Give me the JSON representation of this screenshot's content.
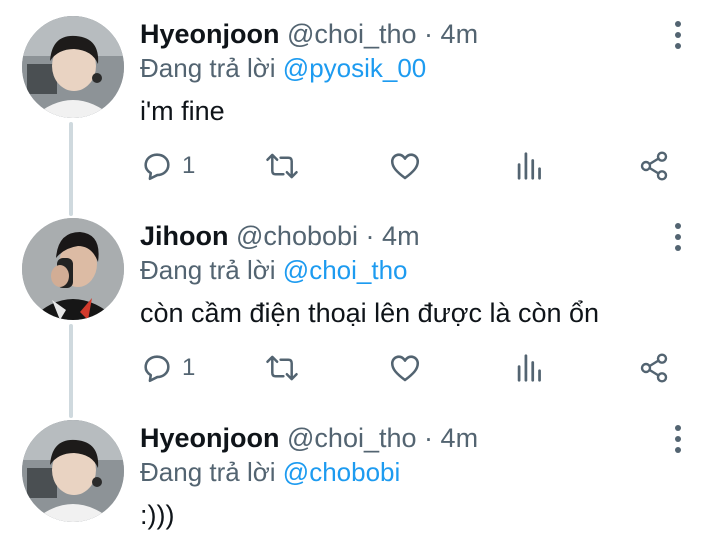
{
  "tweets": [
    {
      "name": "Hyeonjoon",
      "handle": "@choi_tho",
      "separator": "·",
      "time": "4m",
      "reply_prefix": "Đang trả lời",
      "reply_to": "@pyosik_00",
      "text": "i'm fine",
      "reply_count": "1"
    },
    {
      "name": "Jihoon",
      "handle": "@chobobi",
      "separator": "·",
      "time": "4m",
      "reply_prefix": "Đang trả lời",
      "reply_to": "@choi_tho",
      "text": "còn cầm điện thoại lên được là còn ổn",
      "reply_count": "1"
    },
    {
      "name": "Hyeonjoon",
      "handle": "@choi_tho",
      "separator": "·",
      "time": "4m",
      "reply_prefix": "Đang trả lời",
      "reply_to": "@chobobi",
      "text": ":)))"
    }
  ],
  "icons": {
    "reply": "comment-bubble-icon",
    "retweet": "retweet-icon",
    "like": "heart-icon",
    "views": "bar-chart-icon",
    "share": "share-icon",
    "more": "vertical-dots-icon"
  },
  "colors": {
    "name": "#0f1419",
    "secondary": "#536471",
    "mention": "#1d9bf0",
    "thread_line": "#cfd9de"
  }
}
